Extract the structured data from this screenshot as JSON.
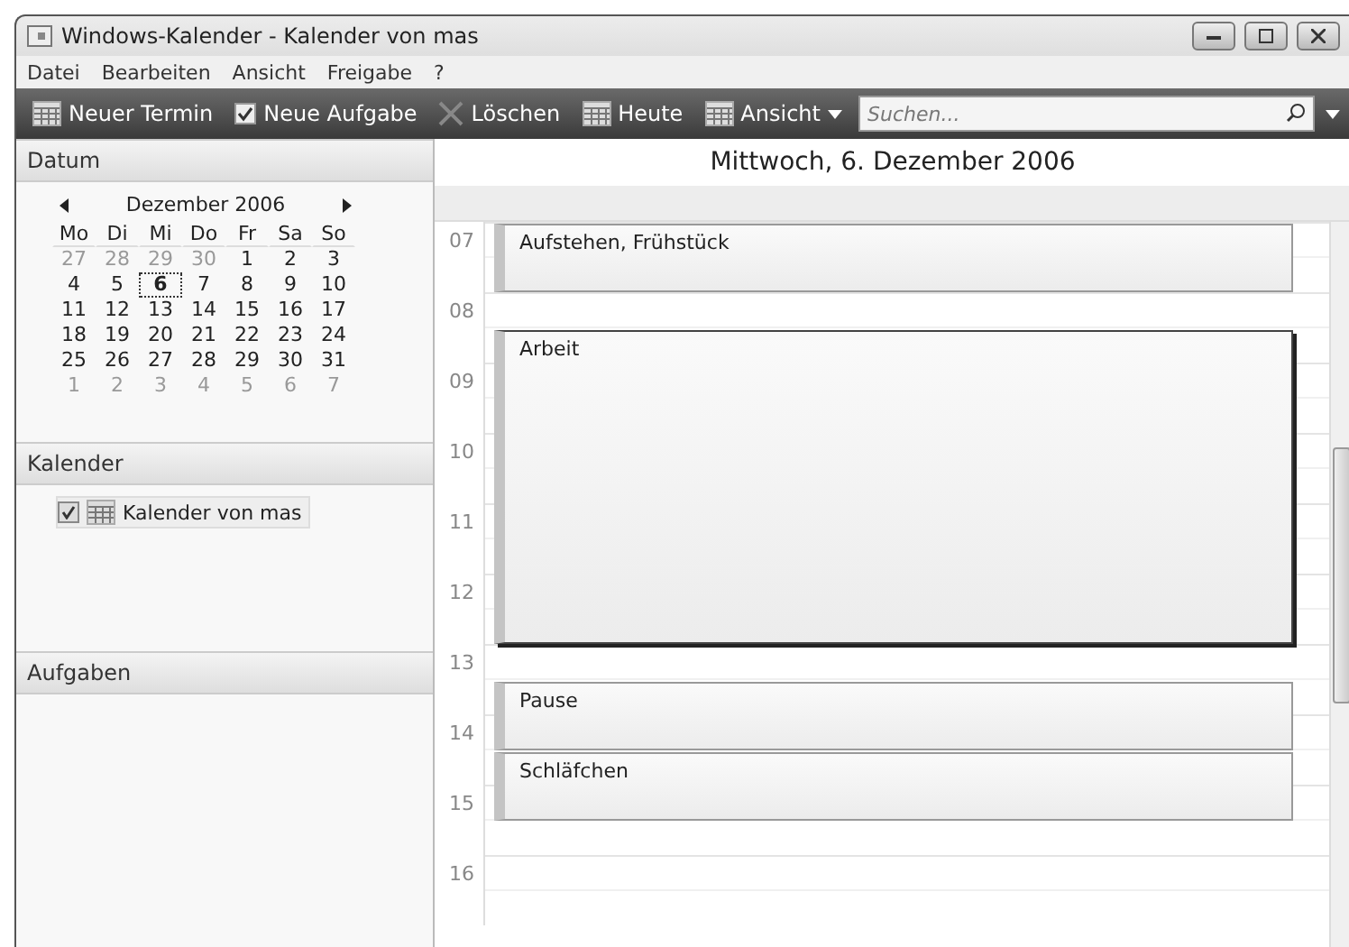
{
  "window": {
    "title": "Windows-Kalender - Kalender von mas"
  },
  "menu": [
    "Datei",
    "Bearbeiten",
    "Ansicht",
    "Freigabe",
    "?"
  ],
  "toolbar": [
    {
      "kind": "new-appointment",
      "label": "Neuer Termin"
    },
    {
      "kind": "new-task",
      "label": "Neue Aufgabe"
    },
    {
      "kind": "delete",
      "label": "Löschen"
    },
    {
      "kind": "today",
      "label": "Heute"
    },
    {
      "kind": "view",
      "label": "Ansicht"
    }
  ],
  "search": {
    "placeholder": "Suchen..."
  },
  "date_pane": {
    "title": "Datum",
    "month": "Dezember 2006",
    "weekdays": [
      "Mo",
      "Di",
      "Mi",
      "Do",
      "Fr",
      "Sa",
      "So"
    ],
    "days": [
      {
        "label": "27",
        "other_month": true,
        "selected": false
      },
      {
        "label": "28",
        "other_month": true,
        "selected": false
      },
      {
        "label": "29",
        "other_month": true,
        "selected": false
      },
      {
        "label": "30",
        "other_month": true,
        "selected": false
      },
      {
        "label": "1",
        "other_month": false,
        "selected": false
      },
      {
        "label": "2",
        "other_month": false,
        "selected": false
      },
      {
        "label": "3",
        "other_month": false,
        "selected": false
      },
      {
        "label": "4",
        "other_month": false,
        "selected": false
      },
      {
        "label": "5",
        "other_month": false,
        "selected": false
      },
      {
        "label": "6",
        "other_month": false,
        "selected": true
      },
      {
        "label": "7",
        "other_month": false,
        "selected": false
      },
      {
        "label": "8",
        "other_month": false,
        "selected": false
      },
      {
        "label": "9",
        "other_month": false,
        "selected": false
      },
      {
        "label": "10",
        "other_month": false,
        "selected": false
      },
      {
        "label": "11",
        "other_month": false,
        "selected": false
      },
      {
        "label": "12",
        "other_month": false,
        "selected": false
      },
      {
        "label": "13",
        "other_month": false,
        "selected": false
      },
      {
        "label": "14",
        "other_month": false,
        "selected": false
      },
      {
        "label": "15",
        "other_month": false,
        "selected": false
      },
      {
        "label": "16",
        "other_month": false,
        "selected": false
      },
      {
        "label": "17",
        "other_month": false,
        "selected": false
      },
      {
        "label": "18",
        "other_month": false,
        "selected": false
      },
      {
        "label": "19",
        "other_month": false,
        "selected": false
      },
      {
        "label": "20",
        "other_month": false,
        "selected": false
      },
      {
        "label": "21",
        "other_month": false,
        "selected": false
      },
      {
        "label": "22",
        "other_month": false,
        "selected": false
      },
      {
        "label": "23",
        "other_month": false,
        "selected": false
      },
      {
        "label": "24",
        "other_month": false,
        "selected": false
      },
      {
        "label": "25",
        "other_month": false,
        "selected": false
      },
      {
        "label": "26",
        "other_month": false,
        "selected": false
      },
      {
        "label": "27",
        "other_month": false,
        "selected": false
      },
      {
        "label": "28",
        "other_month": false,
        "selected": false
      },
      {
        "label": "29",
        "other_month": false,
        "selected": false
      },
      {
        "label": "30",
        "other_month": false,
        "selected": false
      },
      {
        "label": "31",
        "other_month": false,
        "selected": false
      },
      {
        "label": "1",
        "other_month": true,
        "selected": false
      },
      {
        "label": "2",
        "other_month": true,
        "selected": false
      },
      {
        "label": "3",
        "other_month": true,
        "selected": false
      },
      {
        "label": "4",
        "other_month": true,
        "selected": false
      },
      {
        "label": "5",
        "other_month": true,
        "selected": false
      },
      {
        "label": "6",
        "other_month": true,
        "selected": false
      },
      {
        "label": "7",
        "other_month": true,
        "selected": false
      }
    ]
  },
  "calendars_pane": {
    "title": "Kalender",
    "items": [
      {
        "label": "Kalender von mas",
        "checked": true
      }
    ]
  },
  "tasks_pane": {
    "title": "Aufgaben"
  },
  "day_view": {
    "title": "Mittwoch, 6. Dezember 2006",
    "hours": [
      "07",
      "08",
      "09",
      "10",
      "11",
      "12",
      "13",
      "14",
      "15",
      "16"
    ],
    "half_hour_slots": [
      {
        "kind": "event-start",
        "title": "Aufstehen, Frühstück",
        "selected": false
      },
      {
        "kind": "event-continued"
      },
      {
        "kind": "free"
      },
      {
        "kind": "event-start",
        "title": "Arbeit",
        "selected": true
      },
      {
        "kind": "event-continued"
      },
      {
        "kind": "event-continued"
      },
      {
        "kind": "event-continued"
      },
      {
        "kind": "event-continued"
      },
      {
        "kind": "event-continued"
      },
      {
        "kind": "event-continued"
      },
      {
        "kind": "event-continued"
      },
      {
        "kind": "event-continued"
      },
      {
        "kind": "free"
      },
      {
        "kind": "event-start",
        "title": "Pause",
        "selected": false
      },
      {
        "kind": "event-continued"
      },
      {
        "kind": "event-start",
        "title": "Schläfchen",
        "selected": false
      },
      {
        "kind": "event-continued"
      },
      {
        "kind": "free"
      },
      {
        "kind": "free"
      },
      {
        "kind": "free"
      }
    ]
  }
}
